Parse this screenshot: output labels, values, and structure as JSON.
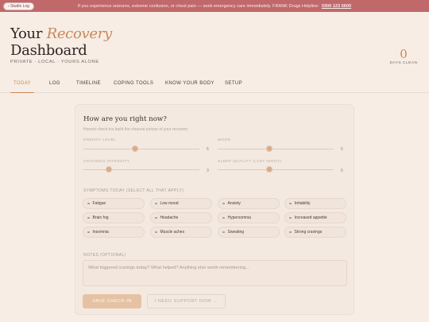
{
  "banner": {
    "text": "If you experience seizures, extreme confusion, or chest pain — seek emergency care immediately. FRANK Drugs Helpline:",
    "phone": "0300 123 6600",
    "studio_button": "‹ Studio Log"
  },
  "header": {
    "title_line1": "Your",
    "title_accent": "Recovery",
    "title_line2": "Dashboard",
    "subtitle": "PRIVATE · LOCAL · YOURS ALONE",
    "days_clean_value": "0",
    "days_clean_label": "DAYS CLEAN"
  },
  "nav": {
    "tabs": [
      "TODAY",
      "LOG",
      "TIMELINE",
      "COPING TOOLS",
      "KNOW YOUR BODY",
      "SETUP"
    ],
    "active": "TODAY"
  },
  "checkin": {
    "title": "How are you right now?",
    "subtitle": "Honest check-ins build the clearest picture of your recovery",
    "sliders": [
      {
        "label": "ENERGY LEVEL",
        "value": 5,
        "display": "5"
      },
      {
        "label": "MOOD",
        "value": 5,
        "display": "5"
      },
      {
        "label": "CRAVINGS INTENSITY",
        "value": 3,
        "display": "3"
      },
      {
        "label": "SLEEP QUALITY (LAST NIGHT)",
        "value": 5,
        "display": "5"
      }
    ],
    "slider_range": [
      1,
      10
    ],
    "symptoms_label": "SYMPTOMS TODAY (SELECT ALL THAT APPLY)",
    "symptoms": [
      "Fatigue",
      "Low mood",
      "Anxiety",
      "Irritability",
      "Brain fog",
      "Headache",
      "Hypersomnia",
      "Increased appetite",
      "Insomnia",
      "Muscle aches",
      "Sweating",
      "Strong cravings"
    ],
    "notes_label": "NOTES (OPTIONAL)",
    "notes_placeholder": "What triggered cravings today? What helped? Anything else worth remembering...",
    "save_label": "SAVE CHECK-IN",
    "support_label": "I NEED SUPPORT NOW →"
  },
  "colors": {
    "accent": "#c8895c",
    "banner": "#c0686a",
    "background": "#f7ede4"
  }
}
